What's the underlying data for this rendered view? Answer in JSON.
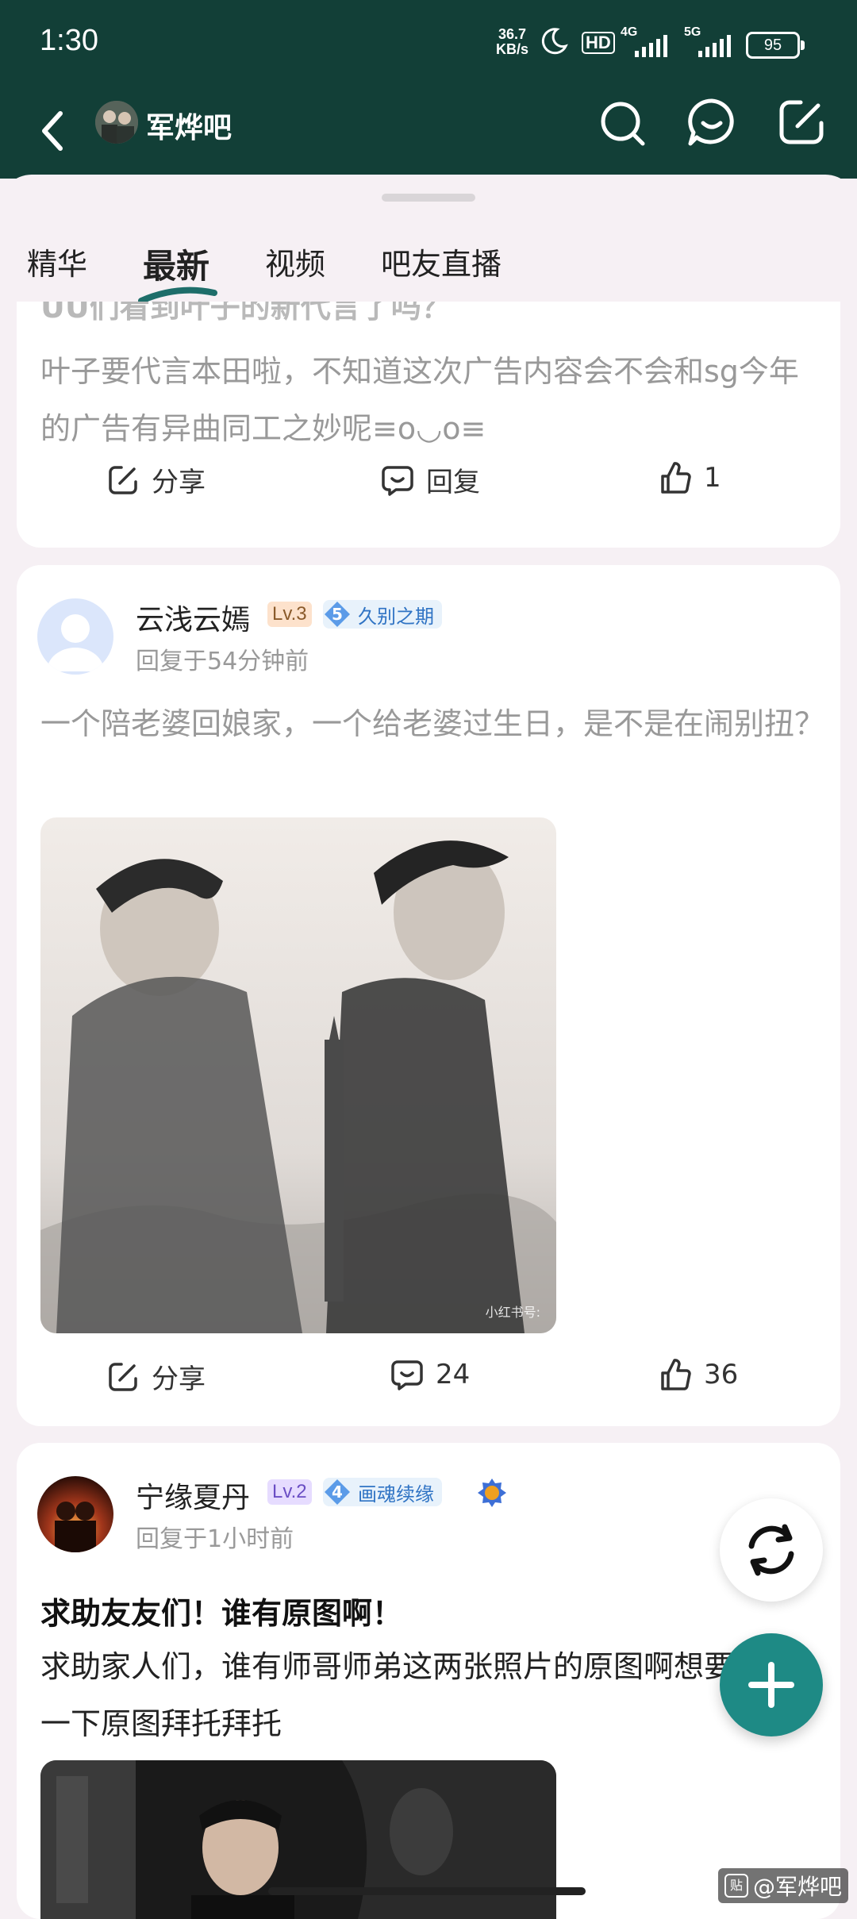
{
  "status": {
    "time": "1:30",
    "net_speed_value": "36.7",
    "net_speed_unit": "KB/s",
    "hd_label": "HD",
    "sig1_label": "4G",
    "sig2_label": "5G",
    "battery": "95"
  },
  "header": {
    "title": "军烨吧"
  },
  "tabs": [
    {
      "label": "精华"
    },
    {
      "label": "最新"
    },
    {
      "label": "视频"
    },
    {
      "label": "吧友直播"
    }
  ],
  "active_tab": "最新",
  "posts": [
    {
      "title": "UU们看到叶子的新代言了吗？",
      "body": "叶子要代言本田啦，不知道这次广告内容会不会和sg今年的广告有异曲同工之妙呢≡o◡o≡",
      "share_label": "分享",
      "comment_label": "回复",
      "like_count": "1"
    },
    {
      "username": "云浅云嫣",
      "level": "Lv.3",
      "badge_num": "5",
      "badge_name": "久别之期",
      "time": "回复于54分钟前",
      "body": "一个陪老婆回娘家，一个给老婆过生日，是不是在闹别扭？",
      "image_watermark": "小红书号:",
      "share_label": "分享",
      "comment_count": "24",
      "like_count": "36"
    },
    {
      "username": "宁缘夏丹",
      "level": "Lv.2",
      "badge_num": "4",
      "badge_name": "画魂续缘",
      "time": "回复于1小时前",
      "title": "求助友友们！谁有原图啊！",
      "body": "求助家人们，谁有师哥师弟这两张照片的原图啊想要一下原图拜托拜托"
    }
  ],
  "footer_watermark": "@军烨吧",
  "footer_logo": "贴",
  "colors": {
    "header_bg": "#123f37",
    "accent": "#1e8a85",
    "badge_blue": "#2f73c4"
  }
}
